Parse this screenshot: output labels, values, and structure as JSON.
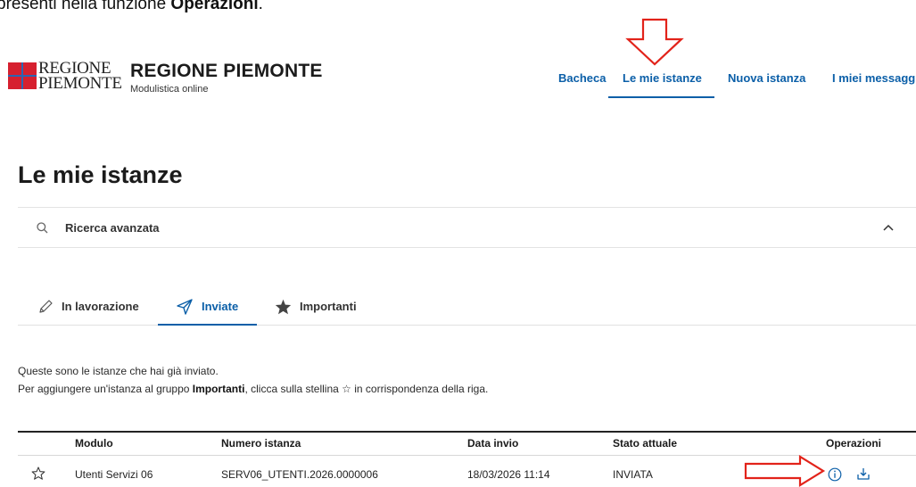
{
  "instruction": {
    "prefix": "presenti nella funzione ",
    "bold": "Operazioni",
    "suffix": "."
  },
  "header": {
    "logo_line1": "REGIONE",
    "logo_line2": "PIEMONTE",
    "title": "REGIONE PIEMONTE",
    "subtitle": "Modulistica online"
  },
  "nav": {
    "items": [
      {
        "label": "Bacheca"
      },
      {
        "label": "Le mie istanze"
      },
      {
        "label": "Nuova istanza"
      },
      {
        "label": "I miei messaggi"
      }
    ],
    "active": "Le mie istanze"
  },
  "page_title": "Le mie istanze",
  "search": {
    "label": "Ricerca avanzata"
  },
  "tabs": [
    {
      "label": "In lavorazione"
    },
    {
      "label": "Inviate"
    },
    {
      "label": "Importanti"
    }
  ],
  "active_tab": "Inviate",
  "description": {
    "line1": "Queste sono le istanze che hai già inviato.",
    "line2_prefix": "Per aggiungere un'istanza al gruppo ",
    "line2_bold": "Importanti",
    "line2_suffix": ", clicca sulla stellina ☆ in corrispondenza della riga."
  },
  "table": {
    "headers": [
      "Modulo",
      "Numero istanza",
      "Data invio",
      "Stato attuale",
      "Operazioni"
    ],
    "rows": [
      {
        "modulo": "Utenti Servizi 06",
        "numero": "SERV06_UTENTI.2026.0000006",
        "data": "18/03/2026 11:14",
        "stato": "INVIATA"
      }
    ]
  },
  "colors": {
    "accent": "#0b5fa8",
    "annotation": "#e2231a",
    "logo_red": "#d6202f"
  },
  "icons": {
    "search": "search-icon",
    "chevron": "chevron-up-icon",
    "pencil": "pencil-icon",
    "send": "send-icon",
    "star_filled": "star-filled-icon",
    "star_outline": "star-outline-icon",
    "info": "info-icon",
    "download": "download-icon"
  }
}
